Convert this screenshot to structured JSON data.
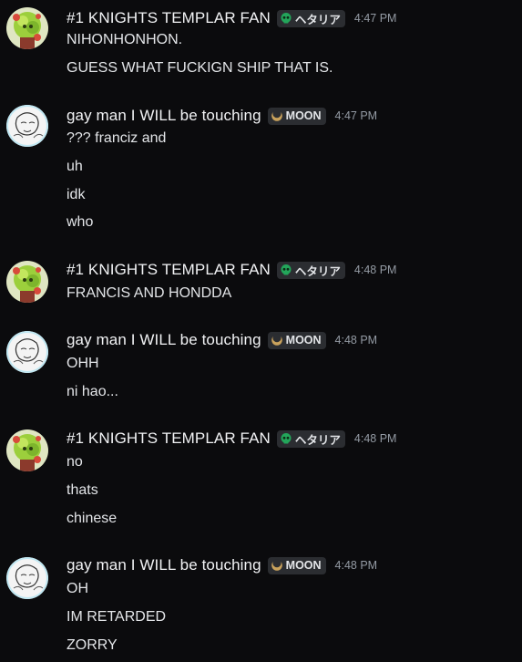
{
  "users": {
    "knight": {
      "name": "#1 KNIGHTS TEMPLAR FAN",
      "tag_label": "ヘタリア",
      "tag_icon": "green-skull-icon",
      "tag_color": "#23a55a"
    },
    "gayman": {
      "name": "gay man I WILL be touching",
      "tag_label": "MOON",
      "tag_icon": "crescent-moon-icon",
      "tag_color": "#c9a25c"
    }
  },
  "groups": [
    {
      "author": "#1 KNIGHTS TEMPLAR FAN",
      "tag": "ヘタリア",
      "time": "4:47 PM",
      "messages": [
        "NIHONHONHON.",
        "GUESS WHAT FUCKIGN SHIP THAT IS."
      ]
    },
    {
      "author": "gay man I WILL be touching",
      "tag": "MOON",
      "time": "4:47 PM",
      "messages": [
        "??? franciz and",
        "uh",
        "idk",
        "who"
      ]
    },
    {
      "author": "#1 KNIGHTS TEMPLAR FAN",
      "tag": "ヘタリア",
      "time": "4:48 PM",
      "messages": [
        "FRANCIS AND HONDDA"
      ]
    },
    {
      "author": "gay man I WILL be touching",
      "tag": "MOON",
      "time": "4:48 PM",
      "messages": [
        "OHH",
        "ni hao..."
      ]
    },
    {
      "author": "#1 KNIGHTS TEMPLAR FAN",
      "tag": "ヘタリア",
      "time": "4:48 PM",
      "messages": [
        "no",
        "thats",
        "chinese"
      ]
    },
    {
      "author": "gay man I WILL be touching",
      "tag": "MOON",
      "time": "4:48 PM",
      "messages": [
        "OH",
        "IM RETARDED",
        "ZORRY"
      ]
    }
  ]
}
